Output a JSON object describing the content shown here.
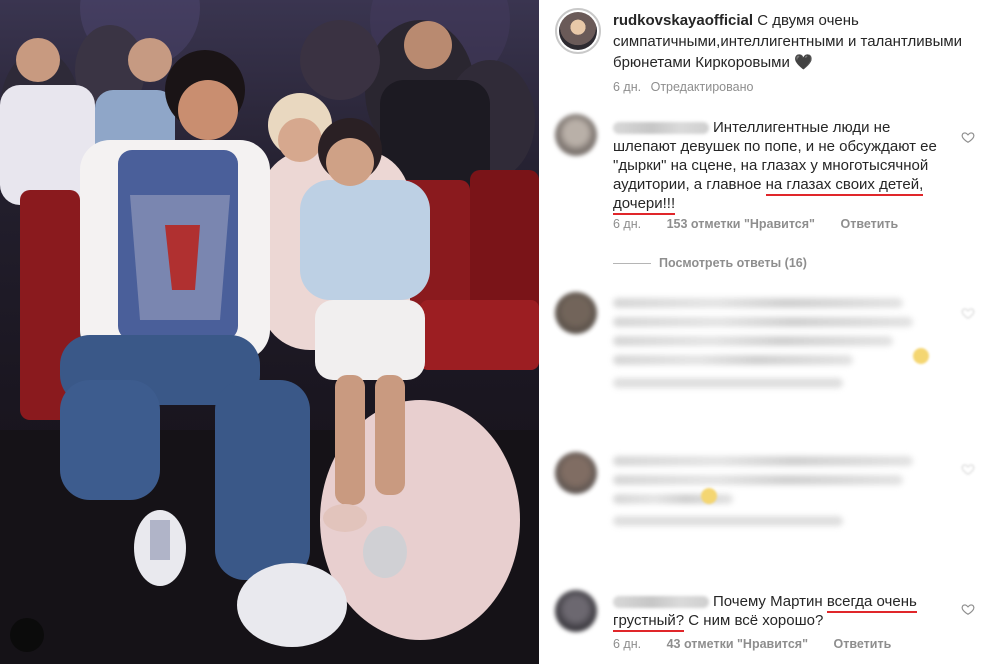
{
  "post": {
    "username": "rudkovskayaofficial",
    "caption": "С двумя очень симпатичными,интеллигентными и талантливыми брюнетами Киркоровыми",
    "caption_emoji": "🖤",
    "time_ago": "6 дн.",
    "edited": "Отредактировано"
  },
  "comments": [
    {
      "text_before": "Интеллигентные люди не шлепают девушек по попе, и не обсуждают ее \"дырки\" на сцене, на глазах у многотысячной аудитории, а главное ",
      "text_underlined": "на глазах своих детей, дочери!!!",
      "time": "6 дн.",
      "likes": "153 отметки \"Нравится\"",
      "reply": "Ответить",
      "view_replies": "Посмотреть ответы (16)"
    },
    {
      "text_before": "Почему Мартин ",
      "text_underlined": "всегда очень грустный?",
      "text_after": " С ним всё хорошо?",
      "time": "6 дн.",
      "likes": "43 отметки \"Нравится\"",
      "reply": "Ответить"
    }
  ],
  "colors": {
    "meta_gray": "#8e8e8e",
    "text": "#262626",
    "underline_red": "#e0262a"
  },
  "icons": [
    "heart-icon"
  ]
}
